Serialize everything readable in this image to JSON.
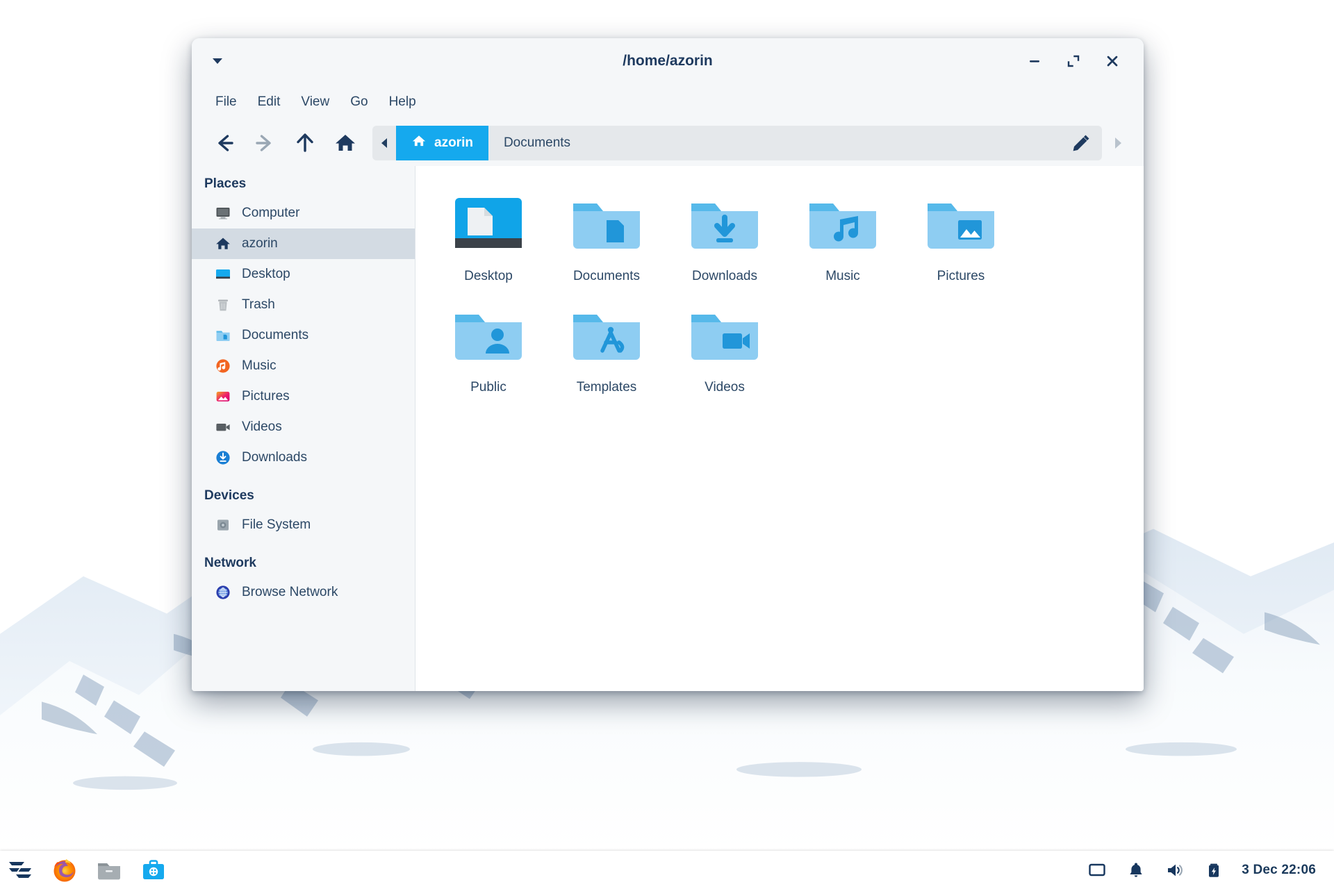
{
  "desktop": {
    "wallpaper": "snowy-mountains",
    "sky_top_color": "#3e6590",
    "sky_bottom_color": "#e9f1f7"
  },
  "window": {
    "title": "/home/azorin",
    "menu_caret_icon": "caret-down-icon",
    "controls": [
      {
        "name": "minimize",
        "icon": "minimize-icon"
      },
      {
        "name": "maximize",
        "icon": "maximize-icon"
      },
      {
        "name": "close",
        "icon": "close-icon"
      }
    ]
  },
  "menubar": {
    "items": [
      {
        "label": "File"
      },
      {
        "label": "Edit"
      },
      {
        "label": "View"
      },
      {
        "label": "Go"
      },
      {
        "label": "Help"
      }
    ]
  },
  "toolbar": {
    "buttons": [
      {
        "name": "back",
        "icon": "arrow-left-icon",
        "enabled": true
      },
      {
        "name": "forward",
        "icon": "arrow-right-icon",
        "enabled": false
      },
      {
        "name": "up",
        "icon": "arrow-up-icon",
        "enabled": true
      },
      {
        "name": "home",
        "icon": "home-icon",
        "enabled": true
      }
    ],
    "path_edit_icon": "pencil-icon",
    "scroll_left_icon": "triangle-left-icon",
    "scroll_right_icon": "triangle-right-icon"
  },
  "breadcrumbs": [
    {
      "label": "azorin",
      "icon": "home-icon",
      "active": true
    },
    {
      "label": "Documents",
      "icon": null,
      "active": false
    }
  ],
  "sidebar": {
    "sections": [
      {
        "title": "Places",
        "items": [
          {
            "label": "Computer",
            "icon": "computer-icon",
            "selected": false
          },
          {
            "label": "azorin",
            "icon": "home-icon",
            "selected": true
          },
          {
            "label": "Desktop",
            "icon": "desktop-icon",
            "selected": false
          },
          {
            "label": "Trash",
            "icon": "trash-icon",
            "selected": false
          },
          {
            "label": "Documents",
            "icon": "folder-documents-icon",
            "selected": false
          },
          {
            "label": "Music",
            "icon": "music-icon",
            "selected": false
          },
          {
            "label": "Pictures",
            "icon": "pictures-icon",
            "selected": false
          },
          {
            "label": "Videos",
            "icon": "videos-icon",
            "selected": false
          },
          {
            "label": "Downloads",
            "icon": "downloads-icon",
            "selected": false
          }
        ]
      },
      {
        "title": "Devices",
        "items": [
          {
            "label": "File System",
            "icon": "drive-icon",
            "selected": false
          }
        ]
      },
      {
        "title": "Network",
        "items": [
          {
            "label": "Browse Network",
            "icon": "network-globe-icon",
            "selected": false
          }
        ]
      }
    ]
  },
  "files": [
    {
      "label": "Desktop",
      "icon": "desktop-folder-icon"
    },
    {
      "label": "Documents",
      "icon": "folder-documents-icon"
    },
    {
      "label": "Downloads",
      "icon": "folder-downloads-icon"
    },
    {
      "label": "Music",
      "icon": "folder-music-icon"
    },
    {
      "label": "Pictures",
      "icon": "folder-pictures-icon"
    },
    {
      "label": "Public",
      "icon": "folder-public-icon"
    },
    {
      "label": "Templates",
      "icon": "folder-templates-icon"
    },
    {
      "label": "Videos",
      "icon": "folder-videos-icon"
    }
  ],
  "taskbar": {
    "launchers": [
      {
        "name": "zorin-menu",
        "icon": "zorin-logo-icon"
      },
      {
        "name": "firefox",
        "icon": "firefox-icon"
      },
      {
        "name": "file-manager",
        "icon": "file-manager-icon"
      },
      {
        "name": "software",
        "icon": "software-icon"
      }
    ],
    "tray": [
      {
        "name": "display",
        "icon": "display-icon"
      },
      {
        "name": "notifications",
        "icon": "bell-icon"
      },
      {
        "name": "volume",
        "icon": "volume-icon"
      },
      {
        "name": "battery",
        "icon": "battery-charging-icon"
      }
    ],
    "clock": "3 Dec 22:06"
  },
  "colors": {
    "accent_blue": "#15a9ee",
    "folder_body": "#8ecdf2",
    "folder_tab": "#56b9ea",
    "folder_emblem": "#2196d9",
    "text_dark": "#2c4866",
    "heading_dark": "#1e3a5f"
  }
}
